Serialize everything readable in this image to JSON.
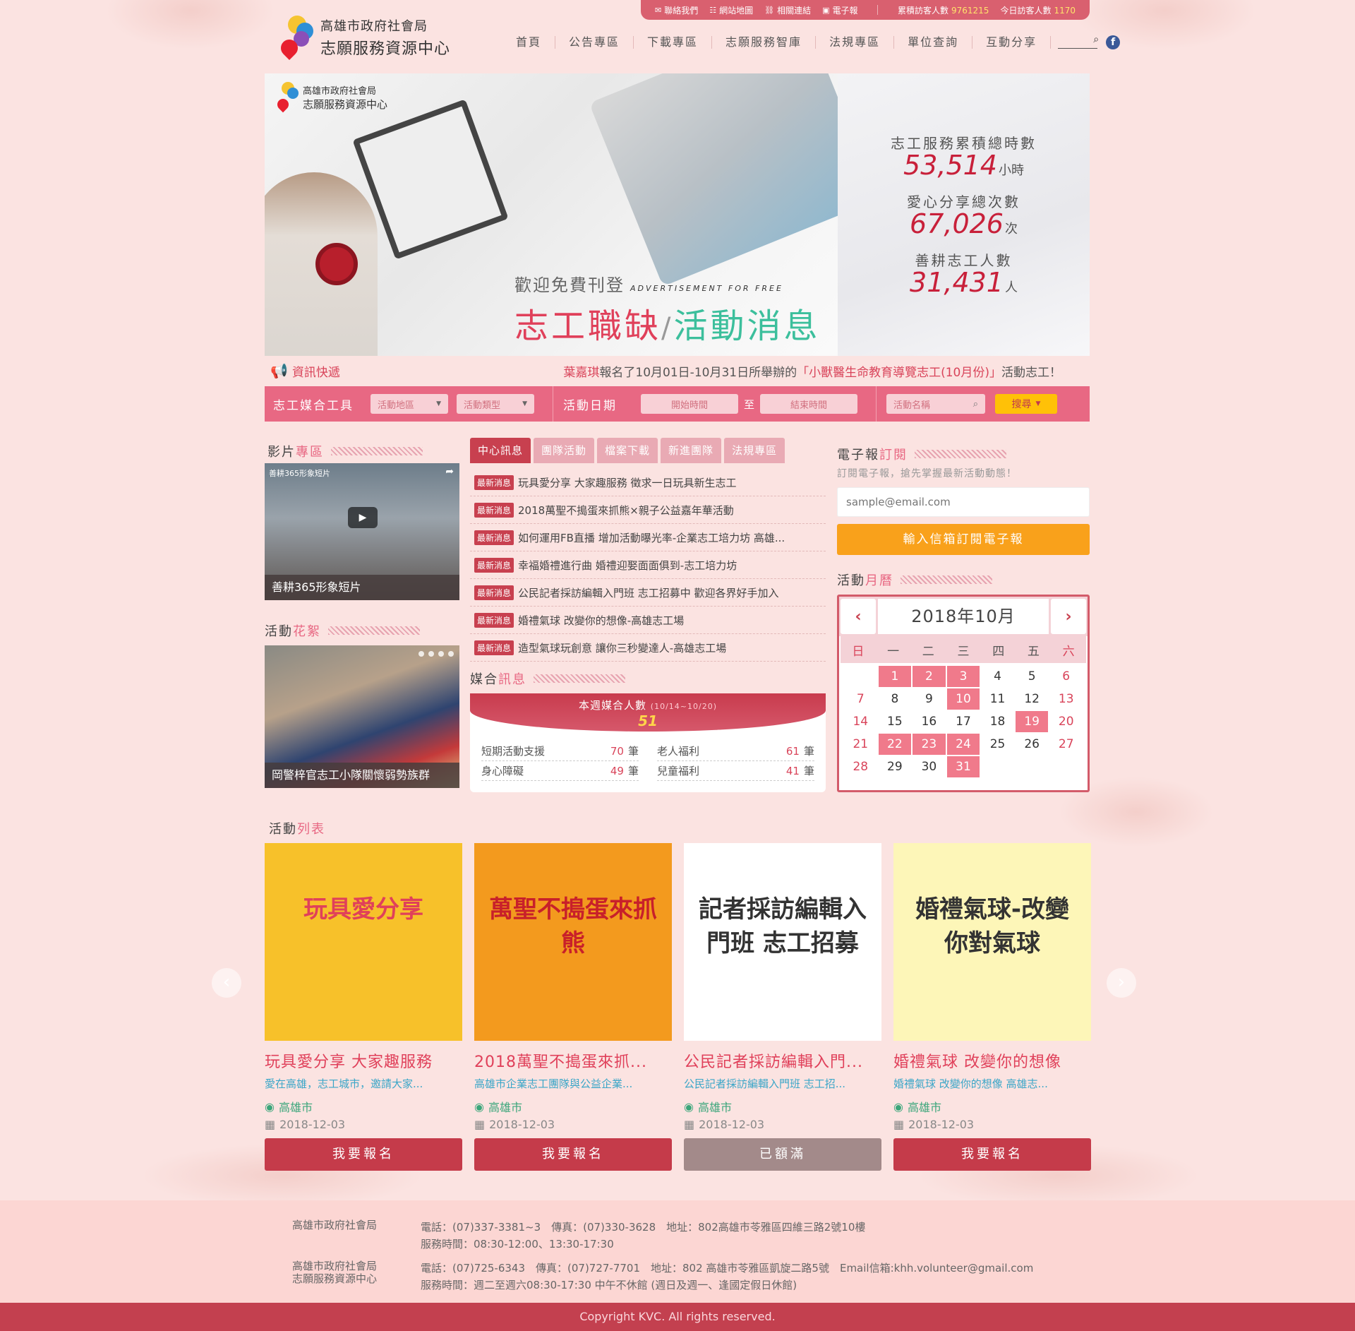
{
  "topbar": {
    "contact": "聯絡我們",
    "sitemap": "網站地圖",
    "links": "相關連結",
    "enews": "電子報",
    "total_visitors_label": "累積訪客人數",
    "total_visitors": "9761215",
    "today_visitors_label": "今日訪客人數",
    "today_visitors": "1170"
  },
  "logo": {
    "line1": "高雄市政府社會局",
    "line2": "志願服務資源中心"
  },
  "nav": [
    "首頁",
    "公告專區",
    "下載專區",
    "志願服務智庫",
    "法規專區",
    "單位查詢",
    "互動分享"
  ],
  "banner": {
    "logo_line1": "高雄市政府社會局",
    "logo_line2": "志願服務資源中心",
    "ad_small": "歡迎免費刊登",
    "ad_small_en": "ADVERTISEMENT FOR FREE",
    "ad_big_a": "志工職缺",
    "ad_big_sep": "/",
    "ad_big_b": "活動消息"
  },
  "stats": [
    {
      "label": "志工服務累積總時數",
      "value": "53,514",
      "unit": "小時"
    },
    {
      "label": "愛心分享總次數",
      "value": "67,026",
      "unit": "次"
    },
    {
      "label": "善耕志工人數",
      "value": "31,431",
      "unit": "人"
    }
  ],
  "ticker": {
    "label": "資訊快遞",
    "name": "葉嘉琪",
    "pre": "報名了10月01日-10月31日所舉辦的",
    "event": "「小獸醫生命教育導覽志工(10月份)」",
    "post": "活動志工！"
  },
  "tool": {
    "title": "志工媒合工具",
    "area": "活動地區",
    "type": "活動類型",
    "date_label": "活動日期",
    "start": "開始時間",
    "to": "至",
    "end": "結束時間",
    "name": "活動名稱",
    "search": "搜尋"
  },
  "video": {
    "title_a": "影片",
    "title_b": "專區",
    "overlay": "善耕365形象短片",
    "caption": "善耕365形象短片"
  },
  "photo": {
    "title_a": "活動",
    "title_b": "花絮",
    "caption": "岡警梓官志工小隊關懷弱勢族群"
  },
  "tabs": [
    "中心訊息",
    "團隊活動",
    "檔案下載",
    "新進團隊",
    "法規專區"
  ],
  "news": {
    "badge": "最新消息",
    "items": [
      "玩具愛分享 大家趣服務 徵求一日玩具新生志工",
      "2018萬聖不搗蛋來抓熊×親子公益嘉年華活動",
      "如何運用FB直播 增加活動曝光率-企業志工培力坊 高雄...",
      "幸福婚禮進行曲 婚禮迎娶面面俱到-志工培力坊",
      "公民記者採訪編輯入門班 志工招募中 歡迎各界好手加入",
      "婚禮氣球 改變你的想像-高雄志工場",
      "造型氣球玩創意 讓你三秒變達人-高雄志工場"
    ]
  },
  "match": {
    "title_a": "媒合",
    "title_b": "訊息",
    "head": "本週媒合人數",
    "range": "(10/14~10/20)",
    "count": "51",
    "unit": "筆",
    "rows": [
      {
        "label": "短期活動支援",
        "value": "70"
      },
      {
        "label": "老人福利",
        "value": "61"
      },
      {
        "label": "身心障礙",
        "value": "49"
      },
      {
        "label": "兒童福利",
        "value": "41"
      }
    ]
  },
  "enews": {
    "title_a": "電子報",
    "title_b": "訂閱",
    "sub": "訂閱電子報，搶先掌握最新活動動態！",
    "placeholder": "sample@email.com",
    "button": "輸入信箱訂閱電子報"
  },
  "calendar": {
    "title_a": "活動",
    "title_b": "月曆",
    "month": "2018年10月",
    "dow": [
      "日",
      "一",
      "二",
      "三",
      "四",
      "五",
      "六"
    ],
    "days": [
      "",
      "1",
      "2",
      "3",
      "4",
      "5",
      "6",
      "7",
      "8",
      "9",
      "10",
      "11",
      "12",
      "13",
      "14",
      "15",
      "16",
      "17",
      "18",
      "19",
      "20",
      "21",
      "22",
      "23",
      "24",
      "25",
      "26",
      "27",
      "28",
      "29",
      "30",
      "31"
    ],
    "event_days": [
      1,
      2,
      3,
      10,
      19,
      22,
      23,
      24,
      31
    ]
  },
  "activities": {
    "title_a": "活動",
    "title_b": "列表",
    "items": [
      {
        "title": "玩具愛分享 大家趣服務",
        "desc": "愛在高雄，志工城市，邀請大家...",
        "loc": "高雄市",
        "date": "2018-12-03",
        "btn": "我要報名",
        "full": false,
        "color": "#f7c12a",
        "text": "玩具愛分享"
      },
      {
        "title": "2018萬聖不搗蛋來抓...",
        "desc": "高雄市企業志工團隊與公益企業...",
        "loc": "高雄市",
        "date": "2018-12-03",
        "btn": "我要報名",
        "full": false,
        "color": "#f39a1e",
        "text": "萬聖不搗蛋來抓熊"
      },
      {
        "title": "公民記者採訪編輯入門...",
        "desc": "公民記者採訪編輯入門班 志工招...",
        "loc": "高雄市",
        "date": "2018-12-03",
        "btn": "已額滿",
        "full": true,
        "color": "#ffffff",
        "text": "記者採訪編輯入門班 志工招募"
      },
      {
        "title": "婚禮氣球 改變你的想像",
        "desc": "婚禮氣球 改變你的想像 高雄志...",
        "loc": "高雄市",
        "date": "2018-12-03",
        "btn": "我要報名",
        "full": false,
        "color": "#fdf6b8",
        "text": "婚禮氣球-改變你對氣球"
      }
    ]
  },
  "footer": {
    "org1": "高雄市政府社會局",
    "info1a": "電話：(07)337-3381~3　傳真：(07)330-3628　地址：802高雄市苓雅區四維三路2號10樓",
    "info1b": "服務時間：08:30-12:00、13:30-17:30",
    "org2a": "高雄市政府社會局",
    "org2b": "志願服務資源中心",
    "info2a": "電話：(07)725-6343　傳真：(07)727-7701　地址：802 高雄市苓雅區凱旋二路5號　Email信箱:khh.volunteer@gmail.com",
    "info2b": "服務時間：週二至週六08:30-17:30 中午不休館 (週日及週一、逢國定假日休館)",
    "copyright": "Copyright KVC. All rights reserved."
  }
}
